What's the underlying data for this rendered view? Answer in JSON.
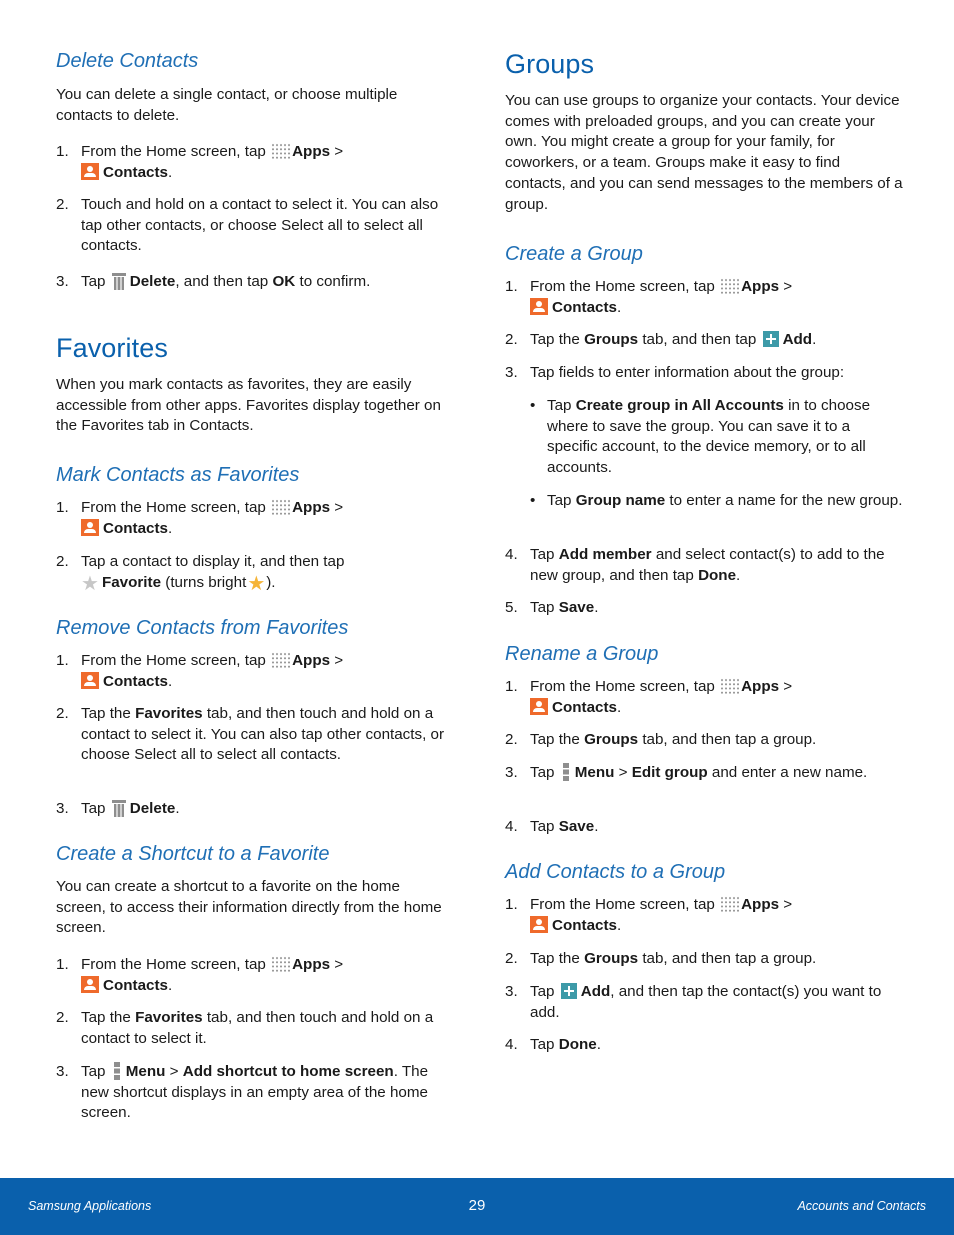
{
  "left": {
    "delete_contacts": {
      "heading": "Delete Contacts",
      "intro": "You can delete a single contact, or choose multiple contacts to delete.",
      "step1": {
        "num": "1.",
        "pre": "From the Home screen, tap",
        "apps": "Apps",
        "sep": ">",
        "contacts": "Contacts",
        "end": "."
      },
      "step2": {
        "num": "2.",
        "text": "Touch and hold on a contact to select it.  You can also tap other contacts, or choose Select all to select all contacts."
      },
      "step3": {
        "num": "3.",
        "pre": "Tap",
        "delete": "Delete",
        "mid": ", and then tap",
        "ok": "OK",
        "end": "to confirm."
      }
    },
    "favorites": {
      "heading": "Favorites",
      "intro": "When you mark contacts as favorites, they are easily accessible from other apps. Favorites display together on the Favorites tab in Contacts."
    },
    "mark_favorites": {
      "heading": "Mark Contacts as Favorites",
      "step1": {
        "num": "1.",
        "pre": "From the Home screen, tap",
        "apps": "Apps",
        "sep": ">",
        "contacts": "Contacts",
        "end": "."
      },
      "step2": {
        "num": "2.",
        "pre": "Tap a contact to display it, and then tap",
        "favorite": "Favorite",
        "mid": "(turns bright",
        "end": ")."
      }
    },
    "remove_favorites": {
      "heading": "Remove Contacts from Favorites",
      "step1": {
        "num": "1.",
        "pre": "From the Home screen, tap",
        "apps": "Apps",
        "sep": ">",
        "contacts": "Contacts",
        "end": "."
      },
      "step2": {
        "num": "2.",
        "pre": "Tap the",
        "favorites": "Favorites",
        "post": "tab, and then touch and hold on a contact to select it. You can also tap other contacts, or choose Select all to select all contacts."
      },
      "step3": {
        "num": "3.",
        "pre": "Tap",
        "delete": "Delete",
        "end": "."
      }
    },
    "shortcut": {
      "heading": "Create a Shortcut to a Favorite",
      "intro": "You can create a shortcut to a favorite on the home screen, to access their information directly from the home screen.",
      "step1": {
        "num": "1.",
        "pre": "From the Home screen, tap",
        "apps": "Apps",
        "sep": ">",
        "contacts": "Contacts",
        "end": "."
      },
      "step2": {
        "num": "2.",
        "pre": "Tap the",
        "favorites": "Favorites",
        "post": "tab, and then touch and hold on a contact to select it."
      },
      "step3": {
        "num": "3.",
        "pre": "Tap",
        "menu": "Menu",
        "sep": ">",
        "action": "Add shortcut to home screen",
        "end": ". The new shortcut displays in an empty area of the home screen."
      }
    }
  },
  "right": {
    "groups": {
      "heading": "Groups",
      "intro": "You can use groups to organize your contacts. Your device comes with preloaded groups, and you can create your own. You might create a group for your family, for coworkers, or a team. Groups make it easy to find contacts, and you can send messages to the members of a group."
    },
    "create_group": {
      "heading": "Create a Group",
      "step1": {
        "num": "1.",
        "pre": "From the Home screen, tap",
        "apps": "Apps",
        "sep": ">",
        "contacts": "Contacts",
        "end": "."
      },
      "step2": {
        "num": "2.",
        "pre": "Tap the",
        "groups": "Groups",
        "mid": "tab, and then tap",
        "add": "Add",
        "end": "."
      },
      "step3": {
        "num": "3.",
        "text": "Tap fields to enter information about the group:"
      },
      "bullet1": {
        "dot": "•",
        "pre": "Tap",
        "bold": "Create group in All Accounts",
        "post": "in to choose where to save the group. You can save it to a specific account, to the device memory, or to all accounts."
      },
      "bullet2": {
        "dot": "•",
        "pre": "Tap",
        "bold": "Group name",
        "post": "to enter a name for the new group."
      },
      "step4": {
        "num": "4.",
        "pre": "Tap",
        "bold": "Add member",
        "mid": "and select contact(s) to add to the new group, and then tap",
        "done": "Done",
        "end": "."
      },
      "step5": {
        "num": "5.",
        "pre": "Tap",
        "save": "Save",
        "end": "."
      }
    },
    "rename_group": {
      "heading": "Rename a Group",
      "step1": {
        "num": "1.",
        "pre": "From the Home screen, tap",
        "apps": "Apps",
        "sep": ">",
        "contacts": "Contacts",
        "end": "."
      },
      "step2": {
        "num": "2.",
        "pre": "Tap the",
        "groups": "Groups",
        "post": "tab, and then tap a group."
      },
      "step3": {
        "num": "3.",
        "pre": "Tap",
        "menu": "Menu",
        "sep": ">",
        "action": "Edit group",
        "post": "and enter a new name."
      },
      "step4": {
        "num": "4.",
        "pre": "Tap",
        "save": "Save",
        "end": "."
      }
    },
    "add_to_group": {
      "heading": "Add Contacts to a Group",
      "step1": {
        "num": "1.",
        "pre": "From the Home screen, tap",
        "apps": "Apps",
        "sep": ">",
        "contacts": "Contacts",
        "end": "."
      },
      "step2": {
        "num": "2.",
        "pre": "Tap the",
        "groups": "Groups",
        "post": "tab, and then tap a group."
      },
      "step3": {
        "num": "3.",
        "pre": "Tap",
        "add": "Add",
        "post": ", and then tap the contact(s) you want to add."
      },
      "step4": {
        "num": "4.",
        "pre": "Tap",
        "done": "Done",
        "end": "."
      }
    }
  },
  "footer": {
    "left": "Samsung Applications",
    "page": "29",
    "right": "Accounts and Contacts"
  },
  "colors": {
    "heading_blue": "#0a60ac",
    "footer_blue": "#0a60ac",
    "contacts_icon": "#ef6a2b",
    "add_icon": "#3d9aa8",
    "star_bright": "#f5b437"
  }
}
